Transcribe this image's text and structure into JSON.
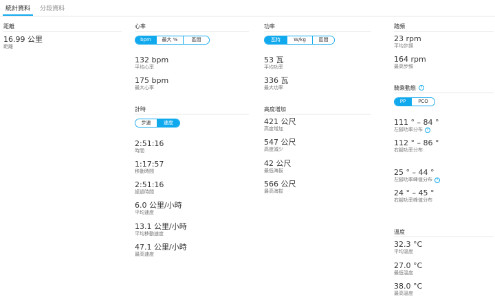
{
  "tabs": [
    {
      "label": "統計資料",
      "active": true
    },
    {
      "label": "分段資料",
      "active": false
    }
  ],
  "distance": {
    "title": "距離",
    "value": "16.99 公里",
    "label": "距離"
  },
  "heart_rate": {
    "title": "心率",
    "toggle": [
      "bpm",
      "最大 %",
      "區間"
    ],
    "toggle_active": 0,
    "avg": {
      "value": "132 bpm",
      "label": "平均心率"
    },
    "max": {
      "value": "175 bpm",
      "label": "最大心率"
    }
  },
  "timing": {
    "title": "計時",
    "toggle": [
      "步速",
      "速度"
    ],
    "toggle_active": 1,
    "items": [
      {
        "value": "2:51:16",
        "label": "時間"
      },
      {
        "value": "1:17:57",
        "label": "移動時間"
      },
      {
        "value": "2:51:16",
        "label": "經過時間"
      },
      {
        "value": "6.0 公里/小時",
        "label": "平均速度"
      },
      {
        "value": "13.1 公里/小時",
        "label": "平均移動速度"
      },
      {
        "value": "47.1 公里/小時",
        "label": "最高速度"
      }
    ]
  },
  "power": {
    "title": "功率",
    "toggle": [
      "瓦特",
      "W/kg",
      "區間"
    ],
    "toggle_active": 0,
    "avg": {
      "value": "53 瓦",
      "label": "平均功率"
    },
    "max": {
      "value": "336 瓦",
      "label": "最大功率"
    }
  },
  "elevation": {
    "title": "高度增加",
    "items": [
      {
        "value": "421 公尺",
        "label": "高度增加"
      },
      {
        "value": "547 公尺",
        "label": "高度減少"
      },
      {
        "value": "42 公尺",
        "label": "最低海拔"
      },
      {
        "value": "566 公尺",
        "label": "最高海拔"
      }
    ]
  },
  "cadence": {
    "title": "踏頻",
    "avg": {
      "value": "23 rpm",
      "label": "平均步頻"
    },
    "max": {
      "value": "164 rpm",
      "label": "最高步頻"
    }
  },
  "dynamics": {
    "title": "騎乘動態",
    "toggle": [
      "PP",
      "PCO"
    ],
    "toggle_active": 0,
    "items": [
      {
        "value": "111 ° – 84 °",
        "label": "左腳功率分布",
        "info": true
      },
      {
        "value": "112 ° – 86 °",
        "label": "右腳功率分布",
        "info": false
      },
      {
        "value": "25 ° – 44 °",
        "label": "左腳功率峰值分布",
        "info": true
      },
      {
        "value": "24 ° – 45 °",
        "label": "右腳功率峰值分布",
        "info": false
      }
    ]
  },
  "temperature": {
    "title": "溫度",
    "items": [
      {
        "value": "32.3 °C",
        "label": "平均溫度"
      },
      {
        "value": "27.0 °C",
        "label": "最低溫度"
      },
      {
        "value": "38.0 °C",
        "label": "最高溫度"
      }
    ]
  },
  "colors": {
    "accent": "#11a9ed"
  }
}
